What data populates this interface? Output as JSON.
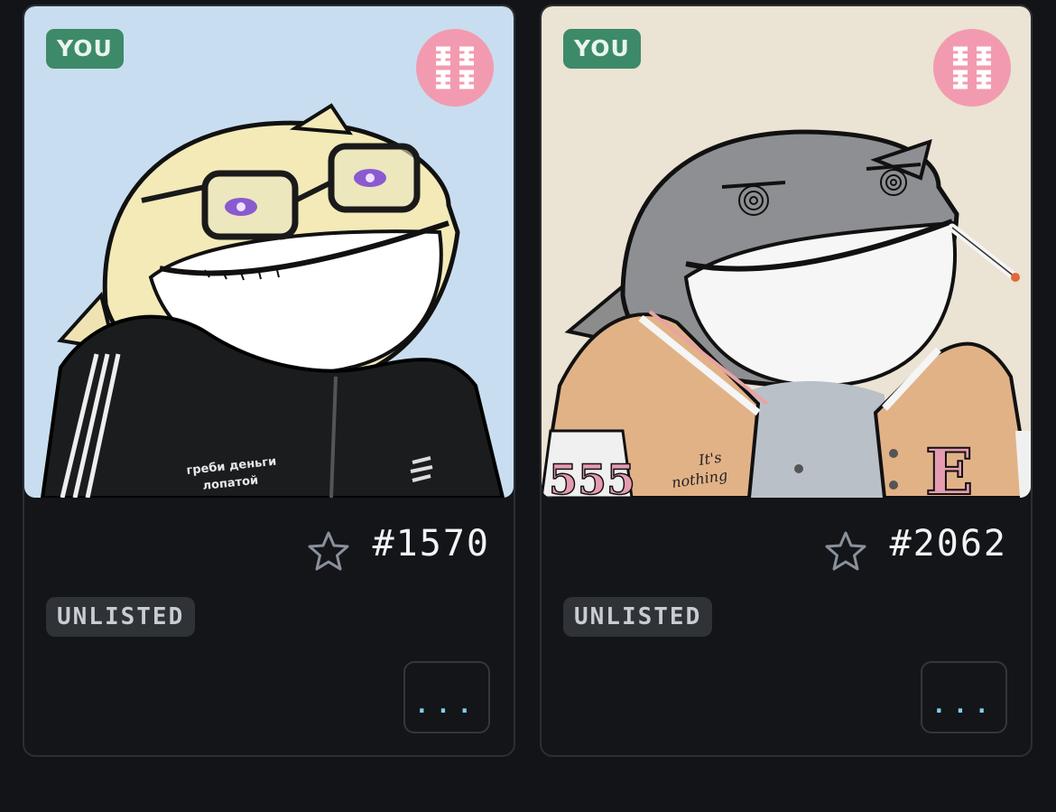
{
  "cards": [
    {
      "owner_badge": "YOU",
      "token_id": "#1570",
      "status": "UNLISTED",
      "more_label": "...",
      "background": "#c8def0",
      "jacket_text_line1": "греби деньги",
      "jacket_text_line2": "лопатой"
    },
    {
      "owner_badge": "YOU",
      "token_id": "#2062",
      "status": "UNLISTED",
      "more_label": "...",
      "background": "#ebe3d3",
      "jacket_text_line1": "It's",
      "jacket_text_line2": "nothing",
      "sleeve_number": "555",
      "patch_letter": "E"
    }
  ],
  "icons": {
    "favorite": "star-outline-icon",
    "brand": "brand-logo-icon"
  },
  "colors": {
    "page_bg": "#121417",
    "card_bg": "#131518",
    "card_border": "#2b2f34",
    "you_badge_bg": "#3d8a68",
    "status_badge_bg": "#2f3236",
    "brand_logo_bg": "#f29bb0",
    "more_dots": "#7fd0ee"
  }
}
